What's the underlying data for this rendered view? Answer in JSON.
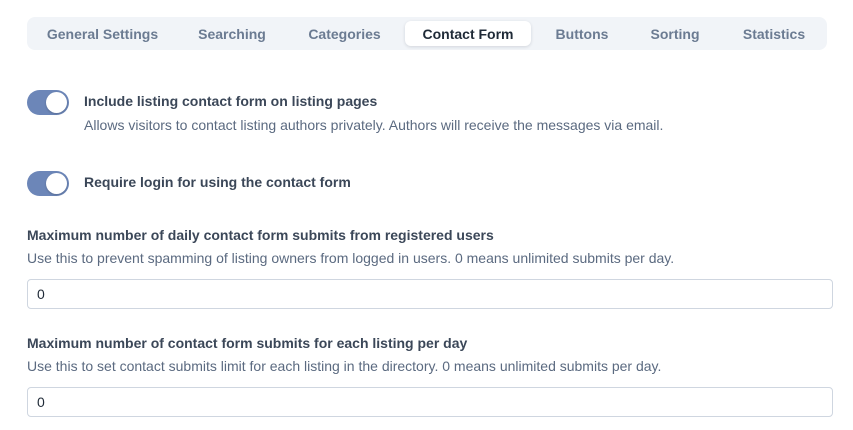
{
  "tabs": [
    {
      "label": "General Settings",
      "active": false
    },
    {
      "label": "Searching",
      "active": false
    },
    {
      "label": "Categories",
      "active": false
    },
    {
      "label": "Contact Form",
      "active": true
    },
    {
      "label": "Buttons",
      "active": false
    },
    {
      "label": "Sorting",
      "active": false
    },
    {
      "label": "Statistics",
      "active": false
    }
  ],
  "settings": {
    "include_contact_form": {
      "label": "Include listing contact form on listing pages",
      "description": "Allows visitors to contact listing authors privately. Authors will receive the messages via email.",
      "enabled": true
    },
    "require_login": {
      "label": "Require login for using the contact form",
      "enabled": true
    },
    "daily_submits": {
      "title": "Maximum number of daily contact form submits from registered users",
      "description": "Use this to prevent spamming of listing owners from logged in users. 0 means unlimited submits per day.",
      "value": "0"
    },
    "listing_submits": {
      "title": "Maximum number of contact form submits for each listing per day",
      "description": "Use this to set contact submits limit for each listing in the directory. 0 means unlimited submits per day.",
      "value": "0"
    }
  },
  "colors": {
    "toggle_on": "#6c86b8",
    "tabbar_bg": "#f1f4f8"
  }
}
